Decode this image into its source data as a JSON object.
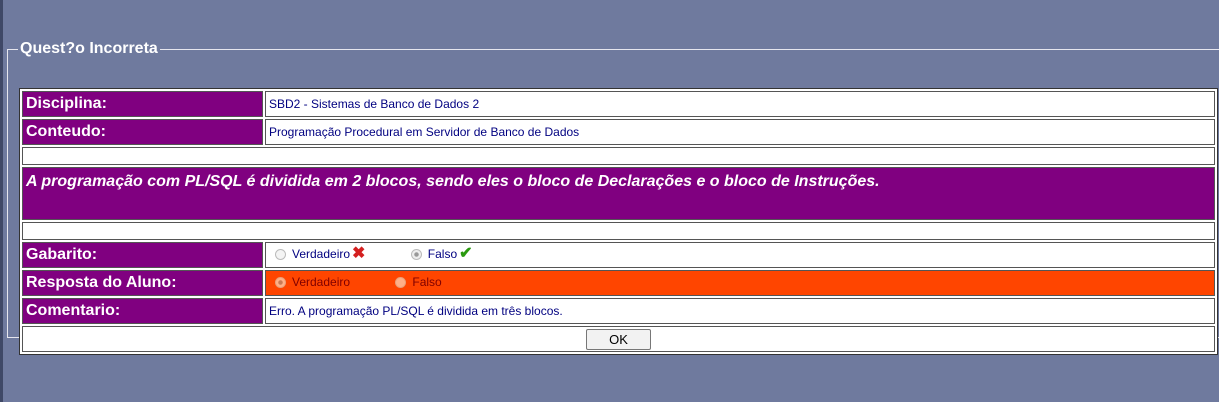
{
  "legend": "Quest?o Incorreta",
  "rows": {
    "disciplina": {
      "label": "Disciplina:",
      "value": "SBD2 - Sistemas de Banco de Dados 2"
    },
    "conteudo": {
      "label": "Conteudo:",
      "value": "Programação Procedural em Servidor de Banco de Dados"
    },
    "question": "A programação com PL/SQL é dividida em 2 blocos, sendo eles o bloco de Declarações e o bloco de Instruções.",
    "gabarito": {
      "label": "Gabarito:",
      "options": [
        {
          "label": "Verdadeiro",
          "selected": false,
          "mark": "✖"
        },
        {
          "label": "Falso",
          "selected": true,
          "mark": "✔"
        }
      ]
    },
    "resposta": {
      "label": "Resposta do Aluno:",
      "options": [
        {
          "label": "Verdadeiro",
          "selected": true
        },
        {
          "label": "Falso",
          "selected": false
        }
      ]
    },
    "comentario": {
      "label": "Comentario:",
      "value": "Erro. A programação PL/SQL é dividida em três blocos."
    }
  },
  "ok_label": "OK",
  "colors": {
    "header": "#800080",
    "wrong_answer": "#ff4500",
    "background": "#6f7a9e"
  }
}
